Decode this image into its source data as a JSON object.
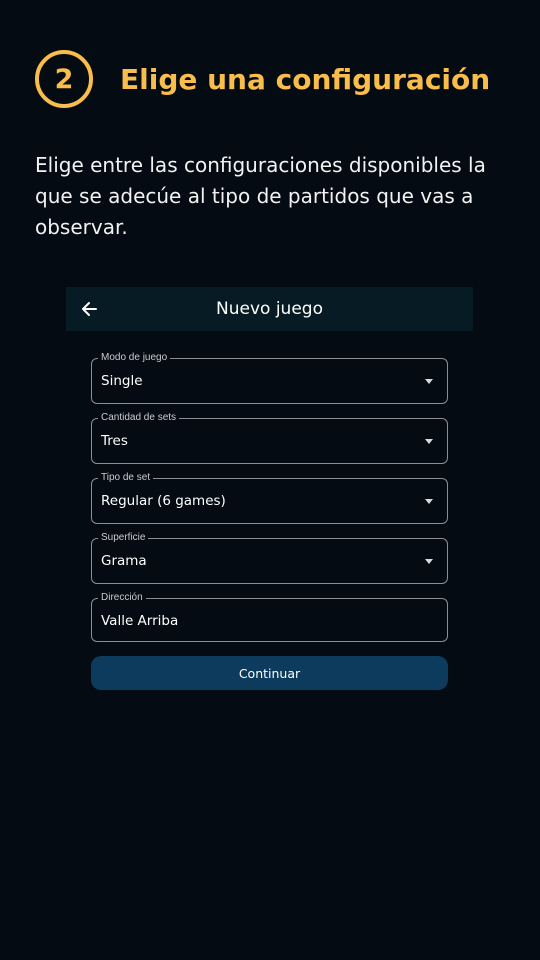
{
  "step": {
    "number": "2",
    "title": "Elige una configuración"
  },
  "description": "Elige entre las configuraciones disponibles la que se adecúe al tipo de partidos que vas a observar.",
  "appbar": {
    "title": "Nuevo juego",
    "back_icon": "arrow-left-icon"
  },
  "form": {
    "fields": [
      {
        "label": "Modo de juego",
        "value": "Single"
      },
      {
        "label": "Cantidad de sets",
        "value": "Tres"
      },
      {
        "label": "Tipo de set",
        "value": "Regular (6 games)"
      },
      {
        "label": "Superficie",
        "value": "Grama"
      },
      {
        "label": "Dirección",
        "value": "Valle Arriba"
      }
    ],
    "continue_label": "Continuar"
  },
  "colors": {
    "background": "#040b12",
    "accent": "#f8bd4b",
    "appbar": "#071b24",
    "button": "#0c3b5d",
    "field_border": "#8b8f94"
  }
}
